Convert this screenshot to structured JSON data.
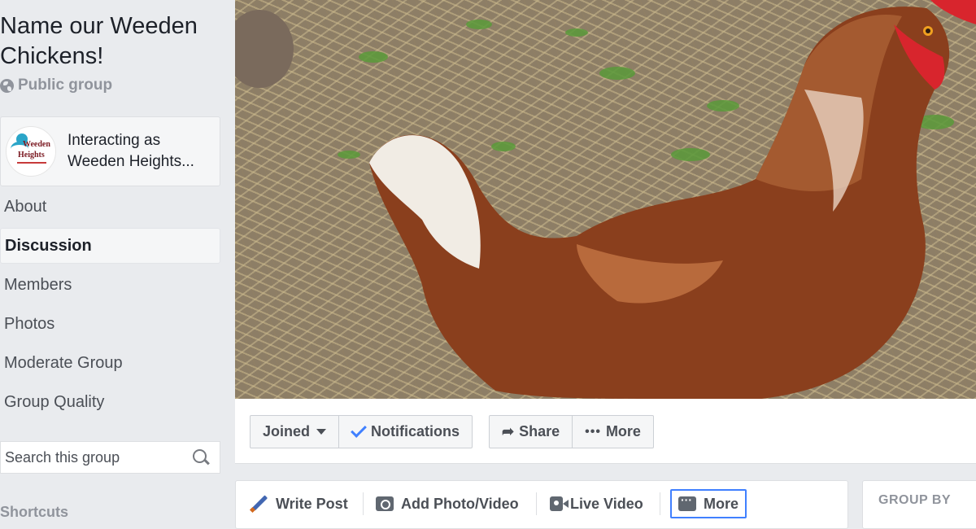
{
  "group": {
    "title": "Name our Weeden Chickens!",
    "privacy": "Public group",
    "interacting_line1": "Interacting as",
    "interacting_line2": "Weeden Heights...",
    "avatar_text_1": "Weeden",
    "avatar_text_2": "Heights"
  },
  "sidebar": {
    "items": [
      {
        "label": "About",
        "active": false
      },
      {
        "label": "Discussion",
        "active": true
      },
      {
        "label": "Members",
        "active": false
      },
      {
        "label": "Photos",
        "active": false
      },
      {
        "label": "Moderate Group",
        "active": false
      },
      {
        "label": "Group Quality",
        "active": false
      }
    ],
    "search_placeholder": "Search this group",
    "shortcuts_heading": "Shortcuts"
  },
  "actions": {
    "joined": "Joined",
    "notifications": "Notifications",
    "share": "Share",
    "more": "More"
  },
  "composer": {
    "write_post": "Write Post",
    "add_photo": "Add Photo/Video",
    "live_video": "Live Video",
    "more": "More"
  },
  "right": {
    "group_by": "GROUP BY"
  },
  "colors": {
    "page_bg": "#e9ebee",
    "accent": "#4080ff",
    "text_muted": "#90949c"
  }
}
